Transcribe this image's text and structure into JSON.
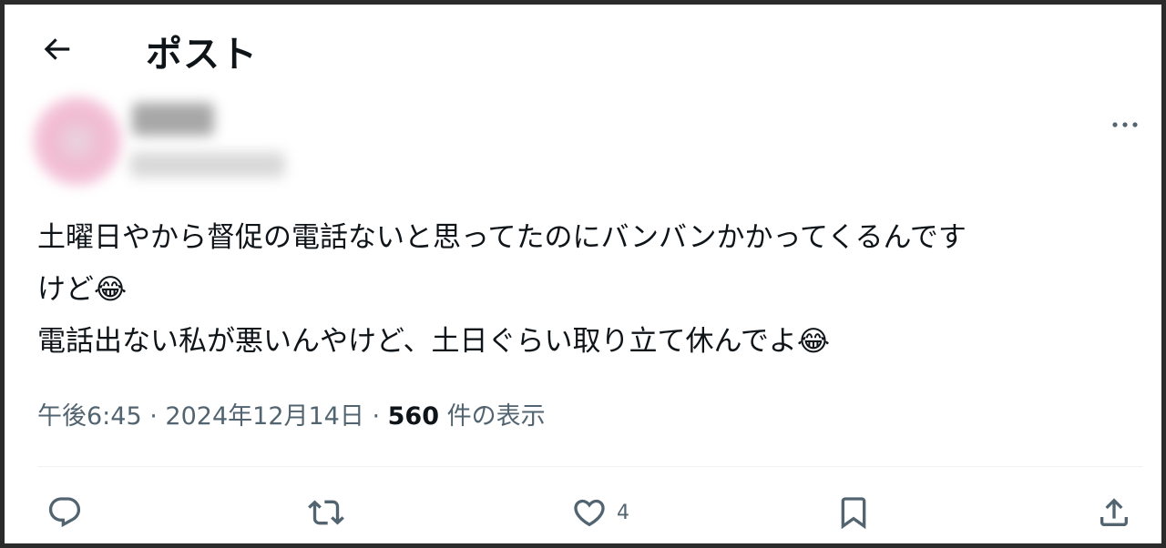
{
  "header": {
    "title": "ポスト",
    "back_icon": "arrow-left-icon"
  },
  "post": {
    "text": "土曜日やから督促の電話ないと思ってたのにバンバンかかってくるんです\nけど😂\n電話出ない私が悪いんやけど、土日ぐらい取り立て休んでよ😂",
    "time": "午後6:45",
    "date": "2024年12月14日",
    "views_count": "560",
    "views_label": "件の表示",
    "separator": "·"
  },
  "actions": {
    "reply_icon": "reply-icon",
    "repost_icon": "repost-icon",
    "like_icon": "heart-icon",
    "like_count": "4",
    "bookmark_icon": "bookmark-icon",
    "share_icon": "share-icon"
  },
  "colors": {
    "text": "#0f1419",
    "secondary_text": "#536471",
    "divider": "#eff3f4",
    "frame": "#2b2b2b"
  }
}
